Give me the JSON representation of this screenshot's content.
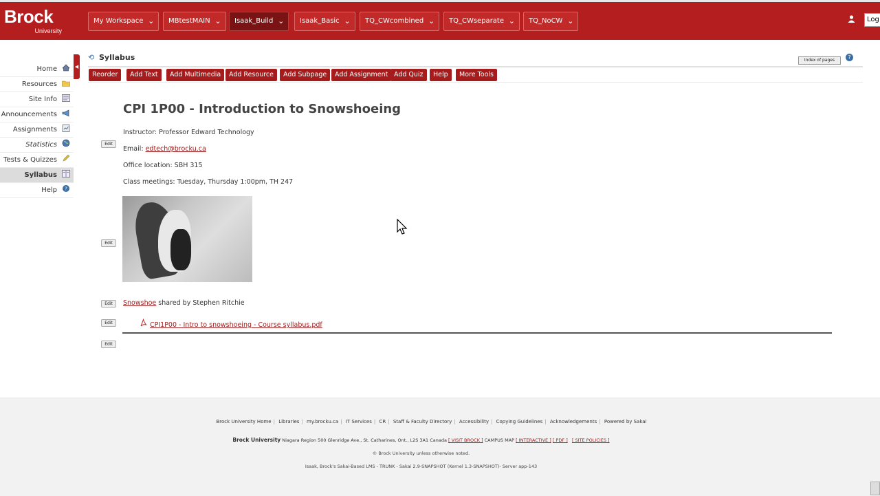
{
  "logo": {
    "brand": "Brock",
    "sub": "University"
  },
  "site_tabs": [
    {
      "label": "My Workspace"
    },
    {
      "label": "MBtestMAIN"
    },
    {
      "label": "Isaak_Build"
    },
    {
      "label": "Isaak_Basic"
    },
    {
      "label": "TQ_CWcombined"
    },
    {
      "label": "TQ_CWseparate"
    },
    {
      "label": "TQ_NoCW"
    }
  ],
  "header": {
    "logout_label": "Log"
  },
  "sidebar": {
    "items": [
      {
        "label": "Home"
      },
      {
        "label": "Resources"
      },
      {
        "label": "Site Info"
      },
      {
        "label": "Announcements"
      },
      {
        "label": "Assignments"
      },
      {
        "label": "Statistics"
      },
      {
        "label": "Tests & Quizzes"
      },
      {
        "label": "Syllabus"
      },
      {
        "label": "Help"
      }
    ]
  },
  "tool": {
    "title": "Syllabus",
    "index_label": "Index of pages"
  },
  "toolbar": {
    "buttons": [
      {
        "label": "Reorder"
      },
      {
        "label": "Add Text"
      },
      {
        "label": "Add Multimedia"
      },
      {
        "label": "Add Resource"
      },
      {
        "label": "Add Subpage"
      },
      {
        "label": "Add Assignment"
      },
      {
        "label": "Add Quiz"
      },
      {
        "label": "Help"
      },
      {
        "label": "More Tools"
      }
    ]
  },
  "content": {
    "edit_label": "Edit",
    "heading": "CPI 1P00 - Introduction to Snowshoeing",
    "instructor": "Instructor: Professor Edward Technology",
    "email_prefix": "Email: ",
    "email": "edtech@brocku.ca",
    "office": "Office location: SBH 315",
    "meetings": "Class meetings: Tuesday, Thursday 1:00pm, TH 247",
    "snowshoe_link": "Snowshoe",
    "snowshoe_suffix": " shared by Stephen Ritchie",
    "pdf_link": "CPI1P00 - Intro to snowshoeing - Course syllabus.pdf"
  },
  "footer": {
    "links": [
      "Brock University Home",
      "Libraries",
      "my.brocku.ca",
      "IT Services",
      "CR",
      "Staff & Faculty Directory",
      "Accessibility",
      "Copying Guidelines",
      "Acknowledgements",
      "Powered by Sakai"
    ],
    "address_name": "Brock University",
    "address": " Niagara Region 500 Glenridge Ave., St. Catharines, Ont., L2S 3A1 Canada ",
    "visit": "[ VISIT BROCK ]",
    "campus_map": " CAMPUS MAP ",
    "interactive": "[ INTERACTIVE ]",
    "pdf": "[ PDF ]",
    "policies": "[ SITE POLICIES ]",
    "copyright": "© Brock University unless otherwise noted.",
    "server": "Isaak, Brock's Sakai-Based LMS - TRUNK - Sakai 2.9-SNAPSHOT (Kernel 1.3-SNAPSHOT)- Server app-143"
  },
  "colors": {
    "brand_red": "#b41e1e",
    "button_red": "#a61b1b",
    "link_red": "#9b1c1c"
  },
  "icons": {
    "home": "home-icon",
    "resources": "folder-icon",
    "site_info": "info-icon",
    "announcements": "megaphone-icon",
    "assignments": "clipboard-icon",
    "statistics": "globe-icon",
    "tests": "pencil-icon",
    "syllabus": "book-icon",
    "help": "help-icon",
    "pdf": "pdf-icon",
    "cursor": "mouse-cursor-icon"
  }
}
